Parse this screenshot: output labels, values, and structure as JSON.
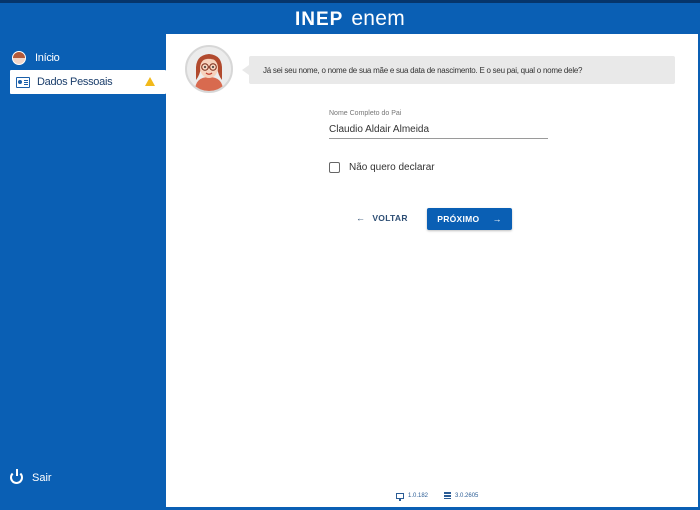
{
  "header": {
    "logo_inep": "INEP",
    "logo_enem": "enem"
  },
  "sidebar": {
    "items": [
      {
        "label": "Início"
      },
      {
        "label": "Dados Pessoais",
        "status": "warning"
      }
    ],
    "logout_label": "Sair"
  },
  "chat": {
    "message": "Já sei seu nome, o nome de sua mãe e sua data de nascimento. E o seu pai, qual o nome dele?"
  },
  "form": {
    "father_name_label": "Nome Completo do Pai",
    "father_name_value": "Claudio Aldair Almeida",
    "no_declare_label": "Não quero declarar",
    "no_declare_checked": false
  },
  "actions": {
    "back_label": "VOLTAR",
    "next_label": "PRÓXIMO"
  },
  "footer": {
    "frontend_version": "1.0.182",
    "backend_version": "3.0.2605"
  },
  "colors": {
    "primary": "#0a5fb4",
    "bubble": "#e9e9e9",
    "warning": "#f2b91a"
  }
}
